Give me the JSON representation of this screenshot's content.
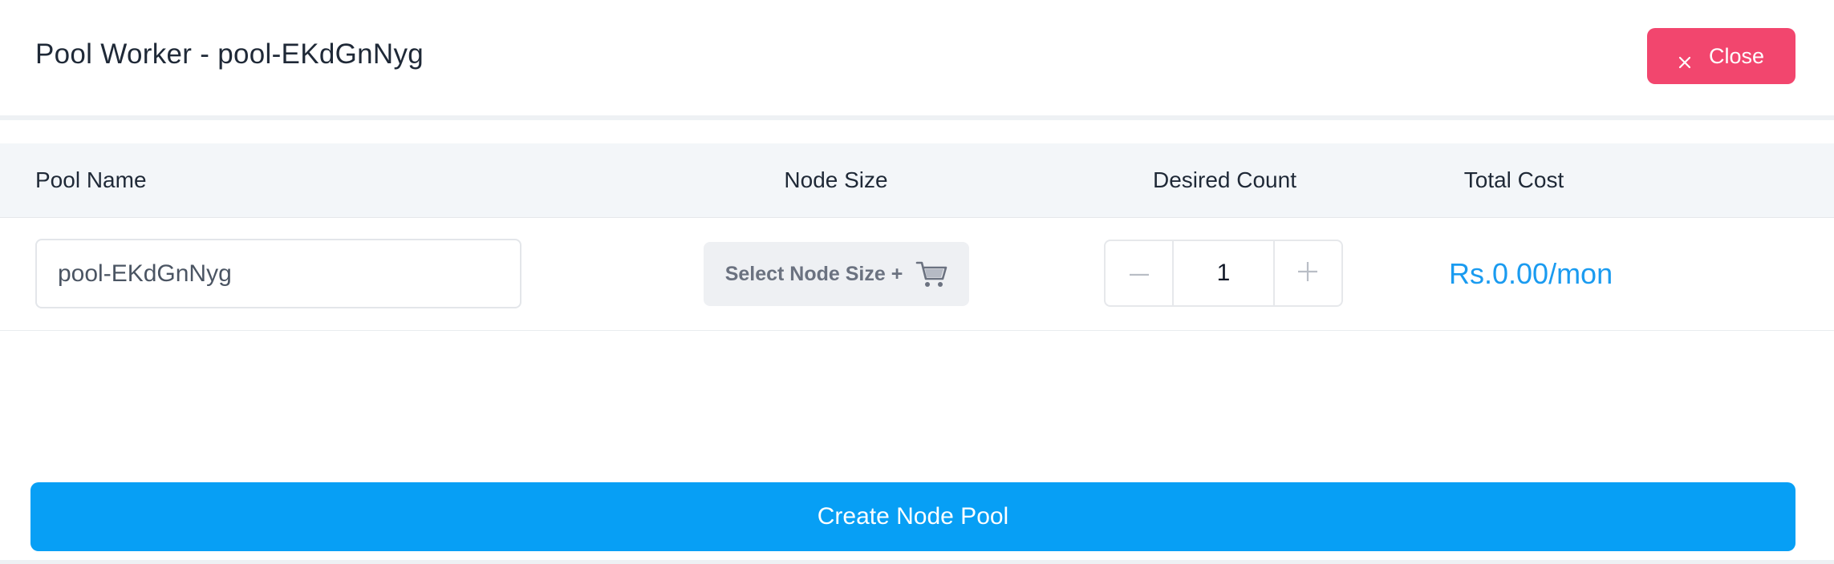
{
  "header": {
    "title": "Pool Worker - pool-EKdGnNyg",
    "close_label": "Close"
  },
  "table": {
    "columns": [
      "Pool Name",
      "Node Size",
      "Desired Count",
      "Total Cost"
    ],
    "row": {
      "pool_name": "pool-EKdGnNyg",
      "node_size_label": "Select Node Size +",
      "desired_count": "1",
      "decrement_symbol": "–",
      "increment_symbol": "+",
      "total_cost": "Rs.0.00/mon"
    }
  },
  "footer": {
    "create_label": "Create Node Pool"
  },
  "colors": {
    "close_button": "#f2466e",
    "primary_button": "#079ff5",
    "cost_text": "#1a9bf0",
    "table_header_bg": "#f3f6f9"
  },
  "icons": {
    "close": "close-icon",
    "cart": "cart-icon",
    "minus": "minus-icon",
    "plus": "plus-icon"
  }
}
